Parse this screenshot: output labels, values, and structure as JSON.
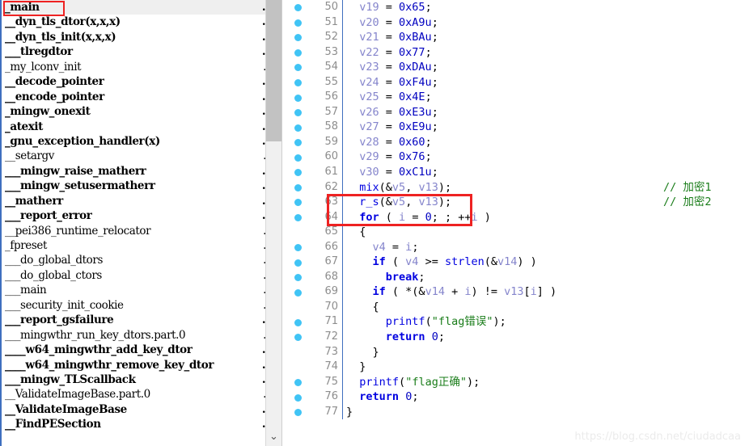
{
  "functions_panel": {
    "segment_label": ".t",
    "selected_index": 0,
    "items": [
      {
        "name": "_main",
        "bold": true
      },
      {
        "name": "__dyn_tls_dtor(x,x,x)",
        "bold": true
      },
      {
        "name": "__dyn_tls_init(x,x,x)",
        "bold": true
      },
      {
        "name": "___tlregdtor",
        "bold": true
      },
      {
        "name": "_my_lconv_init",
        "bold": false
      },
      {
        "name": "__decode_pointer",
        "bold": true
      },
      {
        "name": "__encode_pointer",
        "bold": true
      },
      {
        "name": "_mingw_onexit",
        "bold": true
      },
      {
        "name": "_atexit",
        "bold": true
      },
      {
        "name": "_gnu_exception_handler(x)",
        "bold": true
      },
      {
        "name": "__setargv",
        "bold": false
      },
      {
        "name": "___mingw_raise_matherr",
        "bold": true
      },
      {
        "name": "___mingw_setusermatherr",
        "bold": true
      },
      {
        "name": "__matherr",
        "bold": true
      },
      {
        "name": "___report_error",
        "bold": true
      },
      {
        "name": "__pei386_runtime_relocator",
        "bold": false
      },
      {
        "name": "_fpreset",
        "bold": false
      },
      {
        "name": "___do_global_dtors",
        "bold": false
      },
      {
        "name": "___do_global_ctors",
        "bold": false
      },
      {
        "name": "___main",
        "bold": false
      },
      {
        "name": "___security_init_cookie",
        "bold": false
      },
      {
        "name": "___report_gsfailure",
        "bold": true
      },
      {
        "name": "___mingwthr_run_key_dtors.part.0",
        "bold": false
      },
      {
        "name": "____w64_mingwthr_add_key_dtor",
        "bold": true
      },
      {
        "name": "____w64_mingwthr_remove_key_dtor",
        "bold": true
      },
      {
        "name": "___mingw_TLScallback",
        "bold": true
      },
      {
        "name": "__ValidateImageBase.part.0",
        "bold": false
      },
      {
        "name": "__ValidateImageBase",
        "bold": true
      },
      {
        "name": "__FindPESection",
        "bold": true
      }
    ],
    "scrollbar_down_arrow": "⌄"
  },
  "code_panel": {
    "lines": [
      {
        "num": "50",
        "bullet": true,
        "indent": 2,
        "tokens": [
          {
            "t": "v19",
            "c": "v"
          },
          {
            "t": " = ",
            "c": "pl"
          },
          {
            "t": "0x65",
            "c": "num"
          },
          {
            "t": ";",
            "c": "pl"
          }
        ]
      },
      {
        "num": "51",
        "bullet": true,
        "indent": 2,
        "tokens": [
          {
            "t": "v20",
            "c": "v"
          },
          {
            "t": " = ",
            "c": "pl"
          },
          {
            "t": "0xA9u",
            "c": "num"
          },
          {
            "t": ";",
            "c": "pl"
          }
        ]
      },
      {
        "num": "52",
        "bullet": true,
        "indent": 2,
        "tokens": [
          {
            "t": "v21",
            "c": "v"
          },
          {
            "t": " = ",
            "c": "pl"
          },
          {
            "t": "0xBAu",
            "c": "num"
          },
          {
            "t": ";",
            "c": "pl"
          }
        ]
      },
      {
        "num": "53",
        "bullet": true,
        "indent": 2,
        "tokens": [
          {
            "t": "v22",
            "c": "v"
          },
          {
            "t": " = ",
            "c": "pl"
          },
          {
            "t": "0x77",
            "c": "num"
          },
          {
            "t": ";",
            "c": "pl"
          }
        ]
      },
      {
        "num": "54",
        "bullet": true,
        "indent": 2,
        "tokens": [
          {
            "t": "v23",
            "c": "v"
          },
          {
            "t": " = ",
            "c": "pl"
          },
          {
            "t": "0xDAu",
            "c": "num"
          },
          {
            "t": ";",
            "c": "pl"
          }
        ]
      },
      {
        "num": "55",
        "bullet": true,
        "indent": 2,
        "tokens": [
          {
            "t": "v24",
            "c": "v"
          },
          {
            "t": " = ",
            "c": "pl"
          },
          {
            "t": "0xF4u",
            "c": "num"
          },
          {
            "t": ";",
            "c": "pl"
          }
        ]
      },
      {
        "num": "56",
        "bullet": true,
        "indent": 2,
        "tokens": [
          {
            "t": "v25",
            "c": "v"
          },
          {
            "t": " = ",
            "c": "pl"
          },
          {
            "t": "0x4E",
            "c": "num"
          },
          {
            "t": ";",
            "c": "pl"
          }
        ]
      },
      {
        "num": "57",
        "bullet": true,
        "indent": 2,
        "tokens": [
          {
            "t": "v26",
            "c": "v"
          },
          {
            "t": " = ",
            "c": "pl"
          },
          {
            "t": "0xE3u",
            "c": "num"
          },
          {
            "t": ";",
            "c": "pl"
          }
        ]
      },
      {
        "num": "58",
        "bullet": true,
        "indent": 2,
        "tokens": [
          {
            "t": "v27",
            "c": "v"
          },
          {
            "t": " = ",
            "c": "pl"
          },
          {
            "t": "0xE9u",
            "c": "num"
          },
          {
            "t": ";",
            "c": "pl"
          }
        ]
      },
      {
        "num": "59",
        "bullet": true,
        "indent": 2,
        "tokens": [
          {
            "t": "v28",
            "c": "v"
          },
          {
            "t": " = ",
            "c": "pl"
          },
          {
            "t": "0x60",
            "c": "num"
          },
          {
            "t": ";",
            "c": "pl"
          }
        ]
      },
      {
        "num": "60",
        "bullet": true,
        "indent": 2,
        "tokens": [
          {
            "t": "v29",
            "c": "v"
          },
          {
            "t": " = ",
            "c": "pl"
          },
          {
            "t": "0x76",
            "c": "num"
          },
          {
            "t": ";",
            "c": "pl"
          }
        ]
      },
      {
        "num": "61",
        "bullet": true,
        "indent": 2,
        "tokens": [
          {
            "t": "v30",
            "c": "v"
          },
          {
            "t": " = ",
            "c": "pl"
          },
          {
            "t": "0xC1u",
            "c": "num"
          },
          {
            "t": ";",
            "c": "pl"
          }
        ]
      },
      {
        "num": "62",
        "bullet": true,
        "indent": 2,
        "tokens": [
          {
            "t": "mix",
            "c": "fn"
          },
          {
            "t": "(&",
            "c": "pl"
          },
          {
            "t": "v5",
            "c": "v"
          },
          {
            "t": ", ",
            "c": "pl"
          },
          {
            "t": "v13",
            "c": "v"
          },
          {
            "t": ");",
            "c": "pl"
          }
        ],
        "comment": "// 加密1"
      },
      {
        "num": "63",
        "bullet": true,
        "indent": 2,
        "tokens": [
          {
            "t": "r_s",
            "c": "fn"
          },
          {
            "t": "(&",
            "c": "pl"
          },
          {
            "t": "v5",
            "c": "v"
          },
          {
            "t": ", ",
            "c": "pl"
          },
          {
            "t": "v13",
            "c": "v"
          },
          {
            "t": ");",
            "c": "pl"
          }
        ],
        "comment": "// 加密2"
      },
      {
        "num": "64",
        "bullet": true,
        "indent": 2,
        "tokens": [
          {
            "t": "for",
            "c": "kw"
          },
          {
            "t": " ( ",
            "c": "pl"
          },
          {
            "t": "i",
            "c": "v"
          },
          {
            "t": " = ",
            "c": "pl"
          },
          {
            "t": "0",
            "c": "num"
          },
          {
            "t": "; ; ++",
            "c": "pl"
          },
          {
            "t": "i",
            "c": "v"
          },
          {
            "t": " )",
            "c": "pl"
          }
        ]
      },
      {
        "num": "65",
        "bullet": false,
        "indent": 2,
        "tokens": [
          {
            "t": "{",
            "c": "pl"
          }
        ]
      },
      {
        "num": "66",
        "bullet": true,
        "indent": 4,
        "tokens": [
          {
            "t": "v4",
            "c": "v"
          },
          {
            "t": " = ",
            "c": "pl"
          },
          {
            "t": "i",
            "c": "v"
          },
          {
            "t": ";",
            "c": "pl"
          }
        ]
      },
      {
        "num": "67",
        "bullet": true,
        "indent": 4,
        "tokens": [
          {
            "t": "if",
            "c": "kw"
          },
          {
            "t": " ( ",
            "c": "pl"
          },
          {
            "t": "v4",
            "c": "v"
          },
          {
            "t": " >= ",
            "c": "pl"
          },
          {
            "t": "strlen",
            "c": "fn"
          },
          {
            "t": "(&",
            "c": "pl"
          },
          {
            "t": "v14",
            "c": "v"
          },
          {
            "t": ") )",
            "c": "pl"
          }
        ]
      },
      {
        "num": "68",
        "bullet": true,
        "indent": 6,
        "tokens": [
          {
            "t": "break",
            "c": "kw"
          },
          {
            "t": ";",
            "c": "pl"
          }
        ]
      },
      {
        "num": "69",
        "bullet": true,
        "indent": 4,
        "tokens": [
          {
            "t": "if",
            "c": "kw"
          },
          {
            "t": " ( *(&",
            "c": "pl"
          },
          {
            "t": "v14",
            "c": "v"
          },
          {
            "t": " + ",
            "c": "pl"
          },
          {
            "t": "i",
            "c": "v"
          },
          {
            "t": ") != ",
            "c": "pl"
          },
          {
            "t": "v13",
            "c": "v"
          },
          {
            "t": "[",
            "c": "pl"
          },
          {
            "t": "i",
            "c": "v"
          },
          {
            "t": "] )",
            "c": "pl"
          }
        ]
      },
      {
        "num": "70",
        "bullet": false,
        "indent": 4,
        "tokens": [
          {
            "t": "{",
            "c": "pl"
          }
        ]
      },
      {
        "num": "71",
        "bullet": true,
        "indent": 6,
        "tokens": [
          {
            "t": "printf",
            "c": "fn"
          },
          {
            "t": "(",
            "c": "pl"
          },
          {
            "t": "\"flag错误\"",
            "c": "str"
          },
          {
            "t": ");",
            "c": "pl"
          }
        ]
      },
      {
        "num": "72",
        "bullet": true,
        "indent": 6,
        "tokens": [
          {
            "t": "return",
            "c": "kw"
          },
          {
            "t": " ",
            "c": "pl"
          },
          {
            "t": "0",
            "c": "num"
          },
          {
            "t": ";",
            "c": "pl"
          }
        ]
      },
      {
        "num": "73",
        "bullet": false,
        "indent": 4,
        "tokens": [
          {
            "t": "}",
            "c": "pl"
          }
        ]
      },
      {
        "num": "74",
        "bullet": false,
        "indent": 2,
        "tokens": [
          {
            "t": "}",
            "c": "pl"
          }
        ]
      },
      {
        "num": "75",
        "bullet": true,
        "indent": 2,
        "tokens": [
          {
            "t": "printf",
            "c": "fn"
          },
          {
            "t": "(",
            "c": "pl"
          },
          {
            "t": "\"flag正确\"",
            "c": "str"
          },
          {
            "t": ");",
            "c": "pl"
          }
        ]
      },
      {
        "num": "76",
        "bullet": true,
        "indent": 2,
        "tokens": [
          {
            "t": "return",
            "c": "kw"
          },
          {
            "t": " ",
            "c": "pl"
          },
          {
            "t": "0",
            "c": "num"
          },
          {
            "t": ";",
            "c": "pl"
          }
        ]
      },
      {
        "num": "77",
        "bullet": true,
        "indent": 0,
        "tokens": [
          {
            "t": "}",
            "c": "pl"
          }
        ]
      }
    ]
  },
  "watermark": {
    "text": "https://blog.csdn.net/ciudadcaa"
  },
  "colors": {
    "variable": "#8585cc",
    "number": "#0000c0",
    "keyword": "#0000e0",
    "string_and_comment": "#1a7d1a",
    "bullet": "#40c4f5",
    "annotation_box": "#ee2222",
    "line_number": "#8d8d8d",
    "selected_row_bg": "#efefef"
  }
}
